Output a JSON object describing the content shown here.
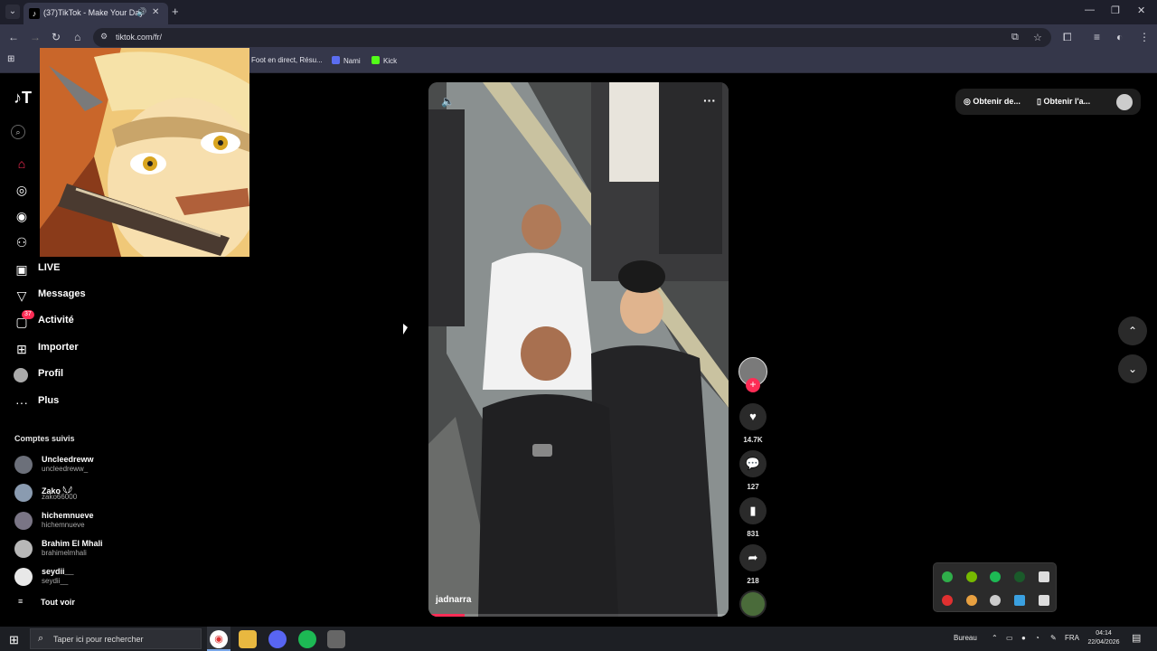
{
  "browser": {
    "tab_title": "(37)TikTok - Make Your Day",
    "url": "tiktok.com/fr/",
    "bookmarks": [
      "Foot en direct, Résu...",
      "Nami",
      "Kick"
    ]
  },
  "sidebar": {
    "nav": [
      {
        "label": "LIVE",
        "icon": "live-icon"
      },
      {
        "label": "Messages",
        "icon": "messages-icon"
      },
      {
        "label": "Activité",
        "icon": "activity-icon",
        "badge": "37"
      },
      {
        "label": "Importer",
        "icon": "upload-icon"
      },
      {
        "label": "Profil",
        "icon": "profile-icon"
      },
      {
        "label": "Plus",
        "icon": "more-icon"
      }
    ],
    "followed_title": "Comptes suivis",
    "followed": [
      {
        "name": "Uncleedreww",
        "handle": "uncleedreww_"
      },
      {
        "name": "Zako 𓆩𓆪",
        "handle": "zako66000"
      },
      {
        "name": "hichemnueve",
        "handle": "hichemnueve"
      },
      {
        "name": "Brahim El Mhali",
        "handle": "brahimelmhali"
      },
      {
        "name": "seydii__",
        "handle": "seydii__"
      }
    ],
    "see_all": "Tout voir"
  },
  "video": {
    "author": "jadnarra",
    "progress": 0.12
  },
  "actions": {
    "likes": "14.7K",
    "comments": "127",
    "saves": "831",
    "shares": "218"
  },
  "topright": {
    "item1": "Obtenir de...",
    "item2": "Obtenir l'a..."
  },
  "taskbar": {
    "search_placeholder": "Taper ici pour rechercher",
    "desktop_label": "Bureau",
    "language": "FRA",
    "time": "04:14",
    "date": "22/04/2026"
  },
  "colors": {
    "accent": "#fe2c55",
    "browser_bg": "#35374a"
  }
}
